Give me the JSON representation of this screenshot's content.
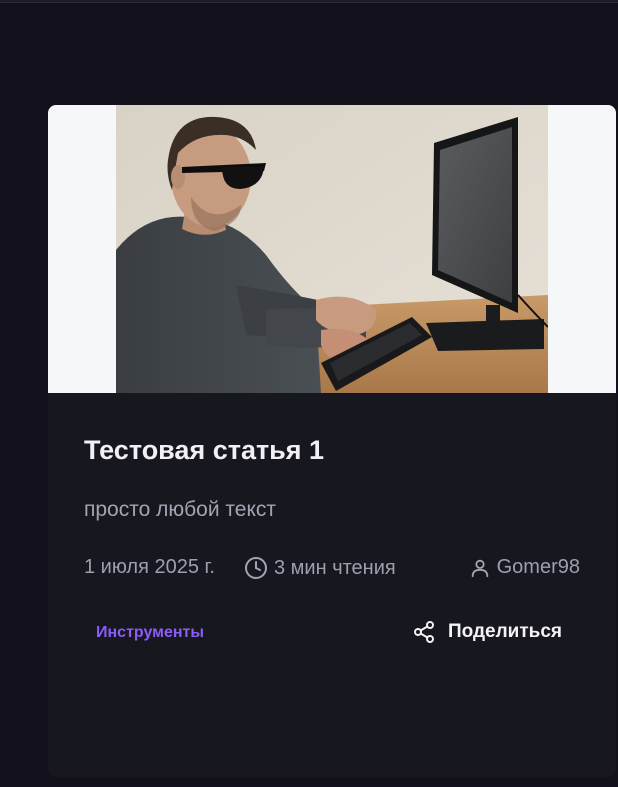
{
  "article": {
    "title": "Тестовая статья 1",
    "excerpt": "просто любой текст",
    "date": "1 июля 2025 г.",
    "read_time": "3 мин чтения",
    "author": "Gomer98",
    "tag": "Инструменты",
    "share_label": "Поделиться",
    "image_alt": "Человек в тёмных очках печатает на клавиатуре за монитором"
  },
  "icons": {
    "clock": "clock-icon",
    "user": "user-icon",
    "share": "share-icon"
  },
  "colors": {
    "background": "#13121c",
    "card": "#171720",
    "accent": "#8b5cf6",
    "title": "#f1f1f5",
    "muted": "#a4a3b3"
  }
}
